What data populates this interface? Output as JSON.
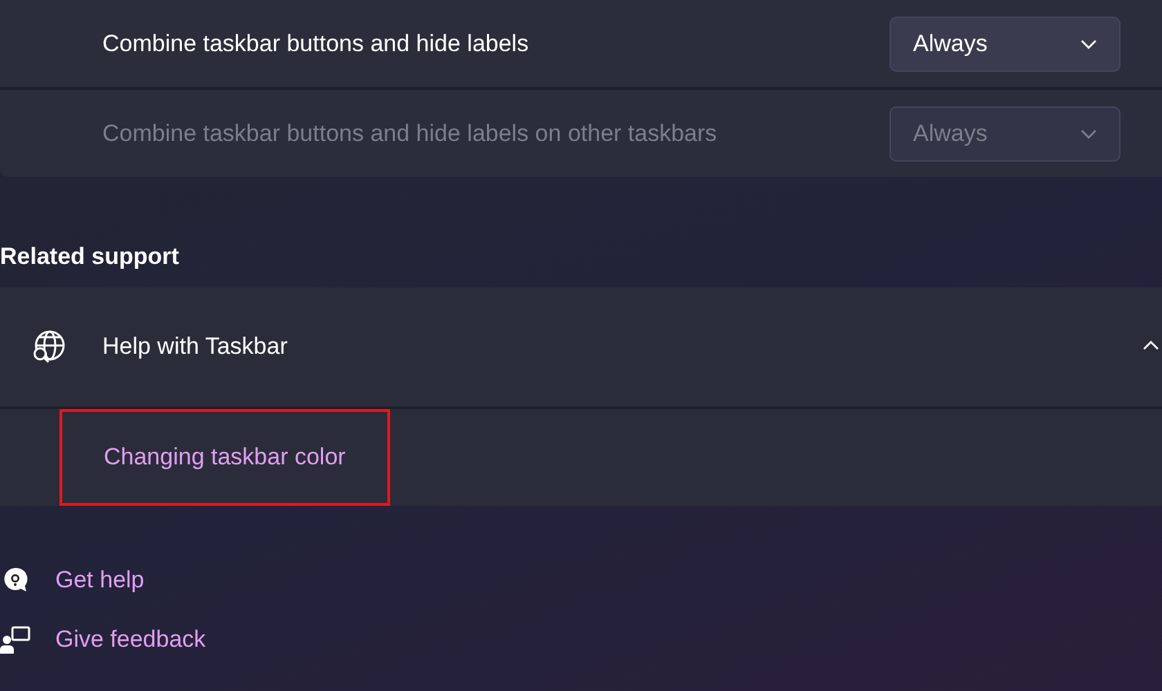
{
  "settings": [
    {
      "label": "Combine taskbar buttons and hide labels",
      "value": "Always",
      "disabled": false
    },
    {
      "label": "Combine taskbar buttons and hide labels on other taskbars",
      "value": "Always",
      "disabled": true
    }
  ],
  "related_support": {
    "heading": "Related support",
    "expander": {
      "title": "Help with Taskbar",
      "expanded": true,
      "links": [
        {
          "label": "Changing taskbar color",
          "highlighted": true
        }
      ]
    }
  },
  "footer_links": [
    {
      "kind": "help",
      "label": "Get help"
    },
    {
      "kind": "feedback",
      "label": "Give feedback"
    }
  ]
}
